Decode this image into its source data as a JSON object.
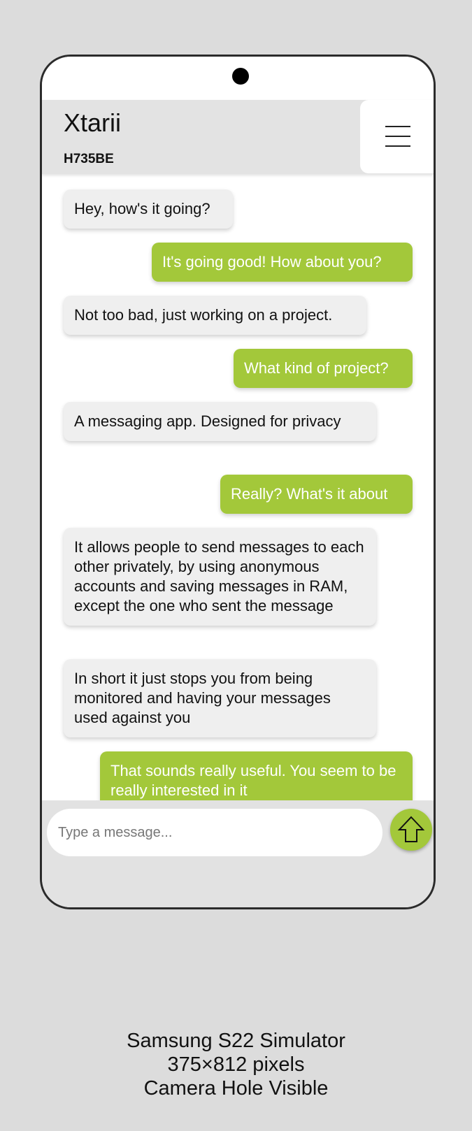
{
  "app": {
    "title": "Xtarii",
    "code": "H735BE"
  },
  "messages": [
    {
      "side": "in",
      "text": "Hey, how's it going?"
    },
    {
      "side": "out",
      "text": "It's going good! How about you?"
    },
    {
      "side": "in",
      "text": "Not too bad, just working on a project."
    },
    {
      "side": "out",
      "text": "What kind of project?"
    },
    {
      "side": "in",
      "text": "A messaging app. Designed for privacy"
    },
    {
      "side": "out",
      "text": "Really? What's it about"
    },
    {
      "side": "in",
      "text": "It allows people to send messages to each other privately, by using anonymous accounts and saving messages in RAM, except the one who sent the message"
    },
    {
      "side": "in",
      "text": "In short it just stops you from being monitored and having your messages used against you"
    },
    {
      "side": "out",
      "text": "That sounds really useful. You seem to be really interested in it"
    }
  ],
  "composer": {
    "placeholder": "Type a message..."
  },
  "caption": {
    "line1": "Samsung S22 Simulator",
    "line2": "375×812 pixels",
    "line3": "Camera Hole Visible"
  },
  "colors": {
    "accent": "#a3c83a",
    "incoming_bubble": "#efefef",
    "background": "#dcdcdc"
  },
  "icons": {
    "menu": "hamburger-menu-icon",
    "send": "up-arrow-icon",
    "camera": "camera-hole"
  }
}
